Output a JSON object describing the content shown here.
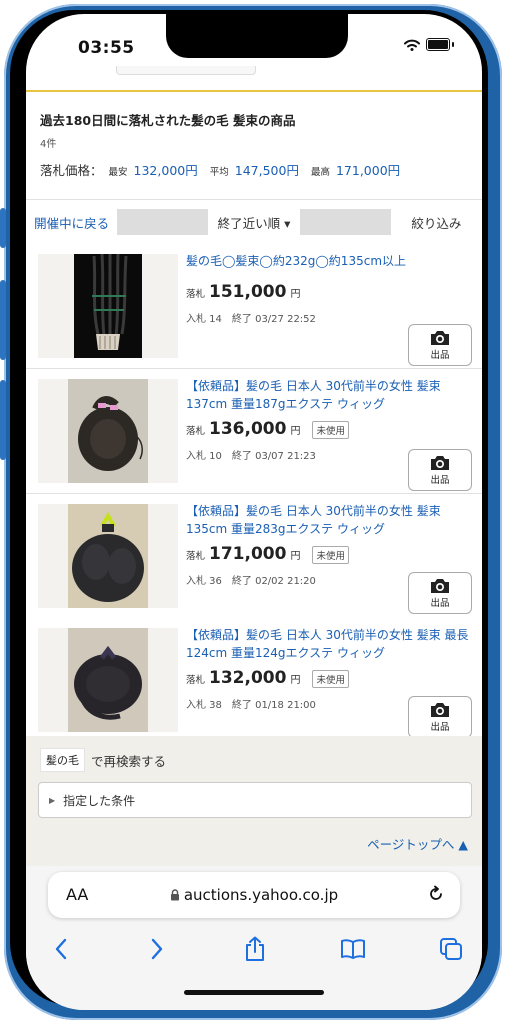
{
  "status_bar": {
    "time": "03:55"
  },
  "summary": {
    "title": "過去180日間に落札された髪の毛 髪束の商品",
    "count": "4件",
    "price_label": "落札価格：",
    "min_label": "最安",
    "min_value": "132,000円",
    "avg_label": "平均",
    "avg_value": "147,500円",
    "max_label": "最高",
    "max_value": "171,000円"
  },
  "toolbar": {
    "back": "開催中に戻る",
    "sort": "終了近い順 ▾",
    "filter": "絞り込み"
  },
  "items": [
    {
      "title": "髪の毛◯髪束◯約232g◯約135cm以上",
      "price_label": "落札",
      "price": "151,000",
      "yen": "円",
      "badge": "",
      "meta": "入札 14　終了 03/27 22:52",
      "button_label": "出品"
    },
    {
      "title": "【依頼品】髪の毛 日本人 30代前半の女性 髪束137cm 重量187gエクステ ウィッグ",
      "price_label": "落札",
      "price": "136,000",
      "yen": "円",
      "badge": "未使用",
      "meta": "入札 10　終了 03/07 21:23",
      "button_label": "出品"
    },
    {
      "title": "【依頼品】髪の毛 日本人 30代前半の女性 髪束135cm 重量283gエクステ ウィッグ",
      "price_label": "落札",
      "price": "171,000",
      "yen": "円",
      "badge": "未使用",
      "meta": "入札 36　終了 02/02 21:20",
      "button_label": "出品"
    },
    {
      "title": "【依頼品】髪の毛 日本人 30代前半の女性 髪束 最長124cm 重量124gエクステ ウィッグ",
      "price_label": "落札",
      "price": "132,000",
      "yen": "円",
      "badge": "未使用",
      "meta": "入札 38　終了 01/18 21:00",
      "button_label": "出品"
    }
  ],
  "research": {
    "keyword": "髪の毛",
    "suffix": "で再検索する"
  },
  "conditions": {
    "label": "指定した条件"
  },
  "page_top": {
    "label": "ページトップへ ▲"
  },
  "browser": {
    "text_size": "AA",
    "url": "auctions.yahoo.co.jp"
  },
  "colors": {
    "link": "#1a5fb4",
    "accent_line": "#e8c440",
    "frame": "#1f63a6"
  }
}
